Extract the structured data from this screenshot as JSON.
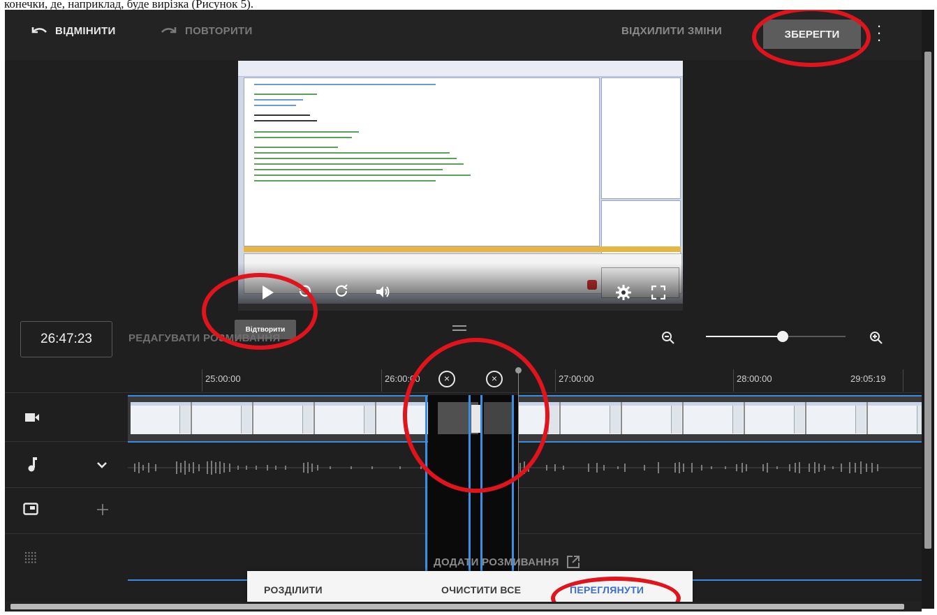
{
  "page_header": "конечки, де, наприклад, буде вирізка (Рисунок 5).",
  "toolbar": {
    "undo_label": "ВІДМІНИТИ",
    "redo_label": "ПОВТОРИТИ",
    "discard_label": "ВІДХИЛИТИ ЗМІНИ",
    "save_label": "ЗБЕРЕГТИ"
  },
  "player": {
    "tooltip": "Відтворити"
  },
  "timeline": {
    "current_time": "26:47:23",
    "edit_blur_label": "РЕДАГУВАТИ РОЗМИВАННЯ",
    "ticks": [
      "25:00:00",
      "26:00:00",
      "27:00:00",
      "28:00:00",
      "29:05:19"
    ],
    "zoom_level": 0.55,
    "add_blur_label": "ДОДАТИ РОЗМИВАННЯ"
  },
  "popup": {
    "split_label": "РОЗДІЛИТИ",
    "clear_label": "ОЧИСТИТИ ВСЕ",
    "preview_label": "ПЕРЕГЛЯНУТИ"
  },
  "colors": {
    "accent_blue": "#3d8be0",
    "annotation_red": "#e0141c",
    "app_background": "#1f1f1f"
  },
  "icons": [
    "undo-icon",
    "redo-icon",
    "kebab-icon",
    "play-icon",
    "replay-icon",
    "forward-icon",
    "volume-icon",
    "settings-icon",
    "fullscreen-icon",
    "zoom-out-icon",
    "zoom-in-icon",
    "video-track-icon",
    "music-note-icon",
    "chevron-down-icon",
    "picture-in-picture-icon",
    "plus-icon",
    "blur-grid-icon",
    "external-link-icon",
    "close-circle-icon"
  ]
}
